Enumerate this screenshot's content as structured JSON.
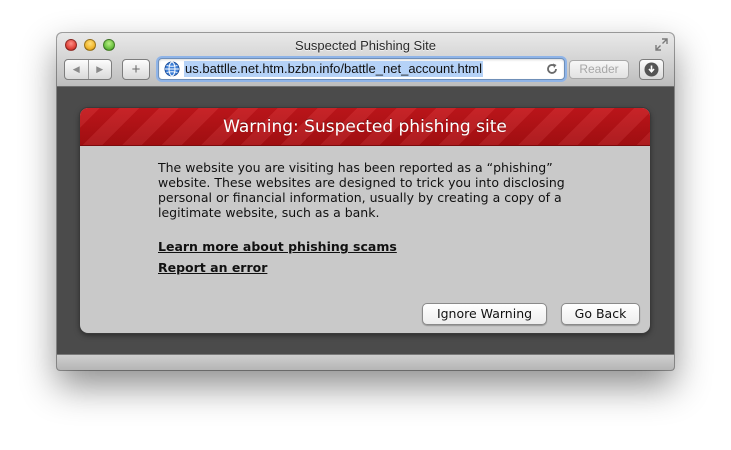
{
  "window": {
    "title": "Suspected Phishing Site"
  },
  "toolbar": {
    "back_icon": "back-arrow-icon",
    "forward_icon": "forward-arrow-icon",
    "add_label": "+",
    "url": "us.battlle.net.htm.bzbn.info/battle_net_account.html",
    "reader_label": "Reader",
    "site_icon": "globe-icon",
    "reload_icon": "reload-icon",
    "downloads_icon": "download-icon"
  },
  "warning": {
    "title": "Warning: Suspected phishing site",
    "message": "The website you are visiting has been reported as a “phishing” website. These websites are designed to trick you into disclosing personal or financial information, usually by creating a copy of a legitimate website, such as a bank.",
    "learn_more_link": "Learn more about phishing scams",
    "report_error_link": "Report an error",
    "ignore_button": "Ignore Warning",
    "go_back_button": "Go Back",
    "header_color": "#b81318"
  }
}
